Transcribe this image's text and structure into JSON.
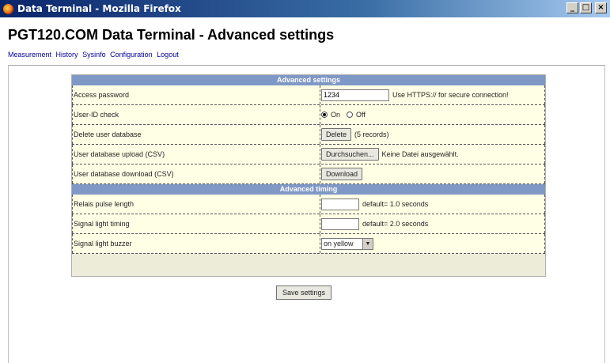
{
  "window": {
    "title": "Data Terminal - Mozilla Firefox"
  },
  "page": {
    "title": "PGT120.COM Data Terminal - Advanced settings"
  },
  "nav": [
    "Measurement",
    "History",
    "Sysinfo",
    "Configuration",
    "Logout"
  ],
  "advanced_settings": {
    "header": "Advanced settings",
    "access_password": {
      "label": "Access password",
      "value": "1234",
      "hint": "Use HTTPS:// for secure connection!"
    },
    "user_id_check": {
      "label": "User-ID check",
      "on_label": "On",
      "off_label": "Off",
      "selected": "On"
    },
    "delete_user_db": {
      "label": "Delete user database",
      "button": "Delete",
      "records": "(5 records)"
    },
    "user_db_upload": {
      "label": "User database upload (CSV)",
      "button": "Durchsuchen...",
      "status": "Keine Datei ausgewählt."
    },
    "user_db_download": {
      "label": "User database download (CSV)",
      "button": "Download"
    }
  },
  "advanced_timing": {
    "header": "Advanced timing",
    "relais_pulse": {
      "label": "Relais pulse length",
      "value": "",
      "default": "default= 1.0 seconds"
    },
    "signal_light": {
      "label": "Signal light timing",
      "value": "",
      "default": "default= 2.0 seconds"
    },
    "signal_buzzer": {
      "label": "Signal light buzzer",
      "selected": "on yellow"
    }
  },
  "save_button": "Save settings"
}
